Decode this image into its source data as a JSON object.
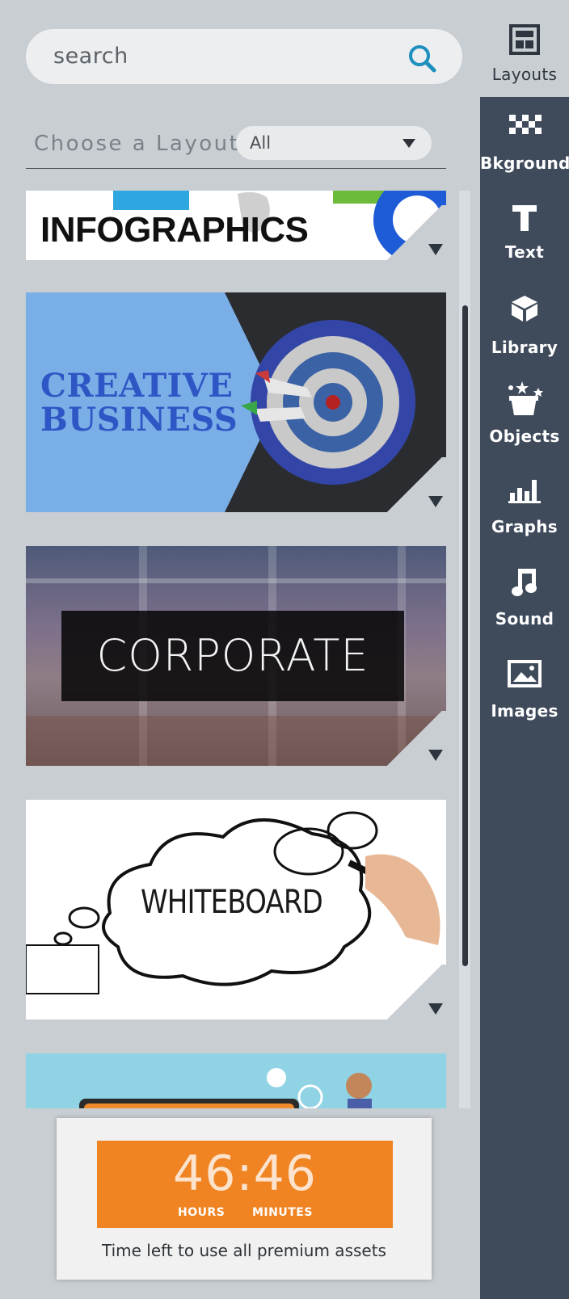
{
  "search": {
    "placeholder": "search"
  },
  "filter": {
    "label": "Choose a Layout",
    "selected": "All"
  },
  "layouts": [
    {
      "title": "INFOGRAPHICS"
    },
    {
      "title_line1": "CREATIVE",
      "title_line2": "BUSINESS"
    },
    {
      "title": "CORPORATE"
    },
    {
      "title": "WHITEBOARD"
    },
    {
      "title": ""
    }
  ],
  "timer": {
    "time": "46:46",
    "hours_label": "HOURS",
    "minutes_label": "MINUTES",
    "note": "Time left to use all premium assets"
  },
  "sidebar": {
    "items": [
      {
        "label": "Layouts",
        "icon": "layouts-icon"
      },
      {
        "label": "Bkground",
        "icon": "background-icon"
      },
      {
        "label": "Text",
        "icon": "text-icon"
      },
      {
        "label": "Library",
        "icon": "library-icon"
      },
      {
        "label": "Objects",
        "icon": "objects-icon"
      },
      {
        "label": "Graphs",
        "icon": "graphs-icon"
      },
      {
        "label": "Sound",
        "icon": "sound-icon"
      },
      {
        "label": "Images",
        "icon": "images-icon"
      }
    ]
  },
  "colors": {
    "panel_bg": "#c9ced3",
    "sidebar_bg": "#3f4a5b",
    "accent_orange": "#f08423",
    "search_icon": "#1e8fbf"
  }
}
